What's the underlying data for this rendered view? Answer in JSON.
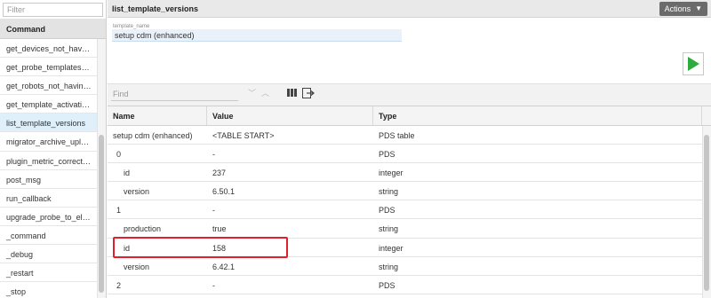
{
  "sidebar": {
    "filter_placeholder": "Filter",
    "header": "Command",
    "items": [
      {
        "label": "get_devices_not_having_g..."
      },
      {
        "label": "get_probe_templates_pac..."
      },
      {
        "label": "get_robots_not_having_pr..."
      },
      {
        "label": "get_template_activation_s..."
      },
      {
        "label": "list_template_versions",
        "active": true
      },
      {
        "label": "migrator_archive_upload"
      },
      {
        "label": "plugin_metric_correction"
      },
      {
        "label": "post_msg"
      },
      {
        "label": "run_callback"
      },
      {
        "label": "upgrade_probe_to_eligible..."
      },
      {
        "label": "_command"
      },
      {
        "label": "_debug"
      },
      {
        "label": "_restart"
      },
      {
        "label": "_stop"
      }
    ]
  },
  "header": {
    "title": "list_template_versions",
    "actions_label": "Actions"
  },
  "params": {
    "label": "template_name",
    "value": "setup cdm (enhanced)"
  },
  "toolbar": {
    "find_placeholder": "Find"
  },
  "grid": {
    "columns": [
      "Name",
      "Value",
      "Type"
    ],
    "rows": [
      {
        "name": "setup cdm (enhanced)",
        "value": "<TABLE START>",
        "type": "PDS table"
      },
      {
        "name": "0",
        "value": "-",
        "type": "PDS"
      },
      {
        "name": "id",
        "value": "237",
        "type": "integer"
      },
      {
        "name": "version",
        "value": "6.50.1",
        "type": "string"
      },
      {
        "name": "1",
        "value": "-",
        "type": "PDS"
      },
      {
        "name": "production",
        "value": "true",
        "type": "string"
      },
      {
        "name": "id",
        "value": "158",
        "type": "integer"
      },
      {
        "name": "version",
        "value": "6.42.1",
        "type": "string"
      },
      {
        "name": "2",
        "value": "-",
        "type": "PDS"
      }
    ]
  },
  "colors": {
    "accent_green": "#2eab3c",
    "highlight_red": "#e0202a",
    "active_item": "#dff0fb"
  }
}
